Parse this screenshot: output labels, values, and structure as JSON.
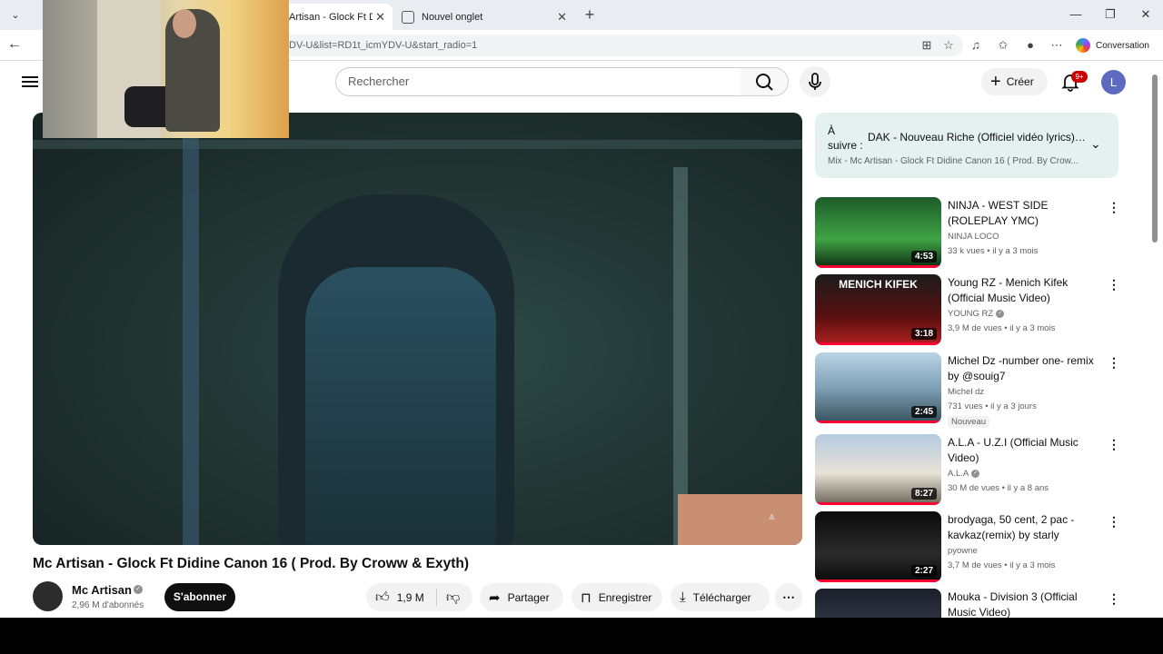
{
  "browser": {
    "tabs": [
      {
        "label": "Artisan - Glock Ft Did",
        "active": true
      },
      {
        "label": "Nouvel onglet",
        "active": false
      }
    ],
    "url": "DV-U&list=RD1t_icmYDV-U&start_radio=1",
    "conversation_label": "Conversation"
  },
  "masthead": {
    "search_placeholder": "Rechercher",
    "create_label": "Créer",
    "notif_count": "9+",
    "user_initial": "L"
  },
  "video": {
    "title": "Mc Artisan - Glock Ft Didine Canon 16 ( Prod. By Croww & Exyth)",
    "channel": "Mc Artisan",
    "subscribers": "2,96 M d'abonnés",
    "subscribe_label": "S'abonner",
    "likes": "1,9 M",
    "share_label": "Partager",
    "save_label": "Enregistrer",
    "download_label": "Télécharger"
  },
  "upnext": {
    "label": "À suivre :",
    "title": "DAK - Nouveau Riche (Officiel vidéo lyrics) ...",
    "subtitle": "Mix - Mc Artisan - Glock Ft Didine Canon 16 ( Prod. By Crow..."
  },
  "recommendations": [
    {
      "title": "NINJA - WEST SIDE (ROLEPLAY YMC)",
      "channel": "NINJA LOCO",
      "meta": "33 k vues • il y a 3 mois",
      "duration": "4:53",
      "verified": false,
      "badge": ""
    },
    {
      "title": "Young RZ - Menich Kifek (Official Music Video)",
      "channel": "YOUNG RZ",
      "meta": "3,9 M de vues • il y a 3 mois",
      "duration": "3:18",
      "verified": true,
      "badge": "",
      "thumb_text": "MENICH KIFEK"
    },
    {
      "title": "Michel Dz -number one- remix by @souig7",
      "channel": "Michel dz",
      "meta": "731 vues • il y a 3 jours",
      "duration": "2:45",
      "verified": false,
      "badge": "Nouveau"
    },
    {
      "title": "A.L.A - U.Z.I (Official Music Video)",
      "channel": "A.L.A",
      "meta": "30 M de vues • il y a 8 ans",
      "duration": "8:27",
      "verified": true,
      "badge": ""
    },
    {
      "title": "brodyaga, 50 cent, 2 pac - kavkaz(remix) by starly",
      "channel": "pyowne",
      "meta": "3,7 M de vues • il y a 3 mois",
      "duration": "2:27",
      "verified": false,
      "badge": ""
    },
    {
      "title": "Mouka - Division 3 (Official Music Video)",
      "channel": "",
      "meta": "",
      "duration": "",
      "verified": false,
      "badge": ""
    }
  ]
}
